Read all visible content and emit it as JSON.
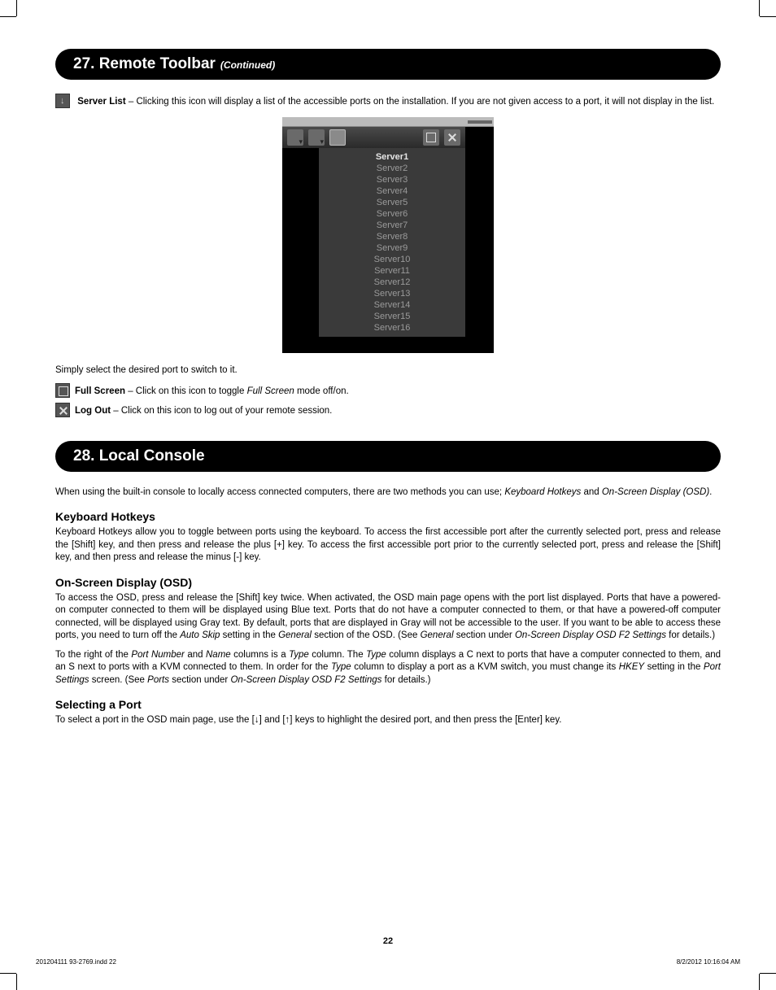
{
  "section27": {
    "title": "27. Remote Toolbar",
    "continued": "(Continued)",
    "server_list_label": "Server List",
    "server_list_text": " – Clicking this icon will display a list of the accessible ports on the installation. If you are not given access to a port, it will not display in the list.",
    "switch_text": "Simply select the desired port to switch to it.",
    "full_screen_label": "Full Screen",
    "full_screen_text_a": " – Click on this icon to toggle ",
    "full_screen_text_i": "Full Screen",
    "full_screen_text_b": " mode off/on.",
    "log_out_label": "Log Out",
    "log_out_text": " – Click on this icon to log out of your remote session."
  },
  "screenshot": {
    "servers": [
      "Server1",
      "Server2",
      "Server3",
      "Server4",
      "Server5",
      "Server6",
      "Server7",
      "Server8",
      "Server9",
      "Server10",
      "Server11",
      "Server12",
      "Server13",
      "Server14",
      "Server15",
      "Server16"
    ],
    "active_index": 0
  },
  "section28": {
    "title": "28. Local Console",
    "intro_a": "When using the built-in console to locally access connected computers, there are two methods you can use; ",
    "intro_i1": "Keyboard Hotkeys",
    "intro_mid": " and ",
    "intro_i2": "On-Screen Display (OSD)",
    "intro_end": ".",
    "kh_head": "Keyboard Hotkeys",
    "kh_text": "Keyboard Hotkeys allow you to toggle between ports using the keyboard. To access the first accessible port after the currently selected port, press and release the [Shift] key, and then press and release the plus [+] key. To access the first accessible port prior to the currently selected port, press and release the [Shift] key, and then press and release the minus [-] key.",
    "osd_head": "On-Screen Display (OSD)",
    "osd_p1_a": "To access the OSD, press and release the [Shift] key twice. When activated, the OSD main page opens with the port list displayed. Ports that have a powered-on computer connected to them will be displayed using Blue text. Ports that do not have a computer connected to them, or that have a powered-off computer connected, will be displayed using Gray text. By default, ports that are displayed in Gray will not be accessible to the user. If you want to be able to access these ports, you need to turn off the ",
    "osd_p1_i1": "Auto Skip",
    "osd_p1_b": " setting in the ",
    "osd_p1_i2": "General",
    "osd_p1_c": " section of the OSD. (See ",
    "osd_p1_i3": "General",
    "osd_p1_d": " section under ",
    "osd_p1_i4": "On-Screen Display OSD F2 Settings",
    "osd_p1_e": " for details.)",
    "osd_p2_a": "To the right of the ",
    "osd_p2_i1": "Port Number",
    "osd_p2_b": " and ",
    "osd_p2_i2": "Name",
    "osd_p2_c": " columns is a ",
    "osd_p2_i3": "Type",
    "osd_p2_d": " column. The ",
    "osd_p2_i4": "Type",
    "osd_p2_e": " column displays a C next to ports that have a computer connected to them, and an S next to ports with a KVM connected to them. In order for the ",
    "osd_p2_i5": "Type",
    "osd_p2_f": " column to display a port as a KVM switch, you must change its ",
    "osd_p2_i6": "HKEY",
    "osd_p2_g": " setting in the ",
    "osd_p2_i7": "Port Settings",
    "osd_p2_h": " screen. (See ",
    "osd_p2_i8": "Ports",
    "osd_p2_i": " section under ",
    "osd_p2_i9": "On-Screen Display OSD F2 Settings",
    "osd_p2_j": " for details.)",
    "sel_head": "Selecting a Port",
    "sel_text": "To select a port in the OSD main page, use the [↓] and [↑] keys to highlight the desired port, and then press the [Enter] key."
  },
  "page_number": "22",
  "footer_left": "201204111 93-2769.indd   22",
  "footer_right": "8/2/2012   10:16:04 AM"
}
